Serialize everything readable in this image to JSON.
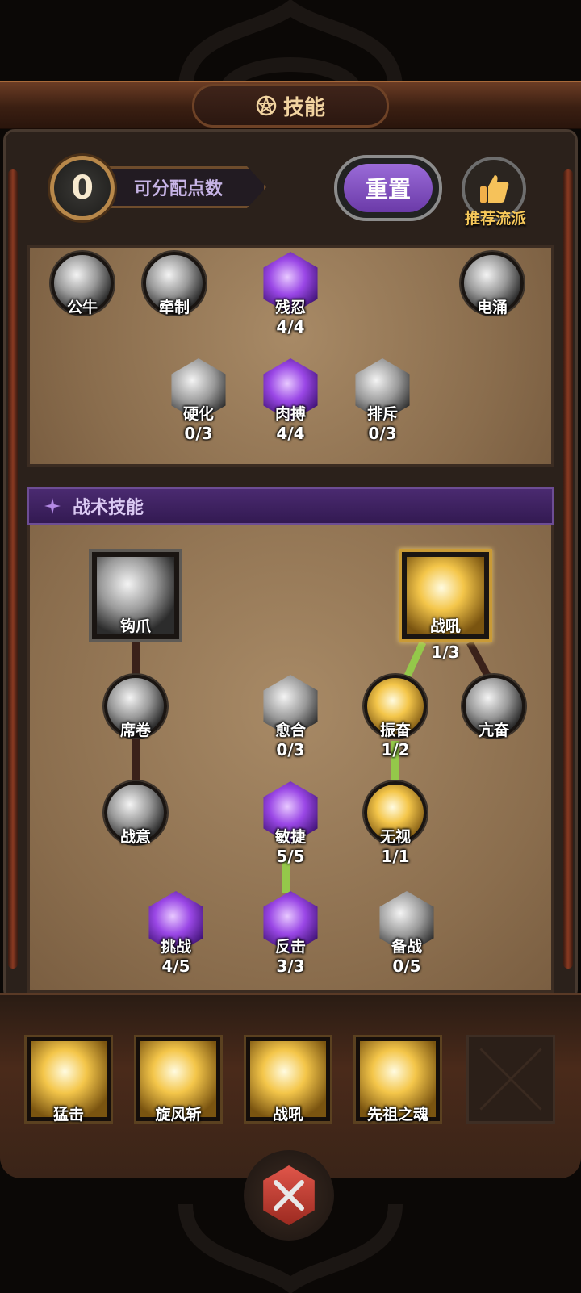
{
  "title": {
    "text": "技能",
    "icon": "pentagram-icon"
  },
  "points": {
    "value": "0",
    "label": "可分配点数"
  },
  "reset_button": "重置",
  "recommend_button": "推荐流派",
  "passive_tree": {
    "row1": [
      {
        "name": "公牛",
        "count": "",
        "style": "gray"
      },
      {
        "name": "牵制",
        "count": "",
        "style": "gray"
      },
      {
        "name": "残忍",
        "count": "4/4",
        "style": "purple"
      },
      {
        "name": "电涌",
        "count": "",
        "style": "gray"
      }
    ],
    "row2": [
      {
        "name": "硬化",
        "count": "0/3",
        "style": "gray"
      },
      {
        "name": "肉搏",
        "count": "4/4",
        "style": "purple"
      },
      {
        "name": "排斥",
        "count": "0/3",
        "style": "gray"
      }
    ]
  },
  "tactical_header": "战术技能",
  "tactical_tree": {
    "hook": {
      "name": "钩爪",
      "count": ""
    },
    "warcry": {
      "name": "战吼",
      "count": "1/3"
    },
    "nodes": {
      "xijuan": {
        "name": "席卷",
        "count": ""
      },
      "zhanyi": {
        "name": "战意",
        "count": ""
      },
      "yuhe": {
        "name": "愈合",
        "count": "0/3"
      },
      "minjie": {
        "name": "敏捷",
        "count": "5/5"
      },
      "zhenfen": {
        "name": "振奋",
        "count": "1/2"
      },
      "kangfen": {
        "name": "亢奋",
        "count": ""
      },
      "wushi": {
        "name": "无视",
        "count": "1/1"
      },
      "tiaozhan": {
        "name": "挑战",
        "count": "4/5"
      },
      "fanji": {
        "name": "反击",
        "count": "3/3"
      },
      "beizhan": {
        "name": "备战",
        "count": "0/5"
      }
    }
  },
  "equipped_skills": [
    "猛击",
    "旋风斩",
    "战吼",
    "先祖之魂"
  ],
  "colors": {
    "accent_purple": "#6b3aa8",
    "gold": "#f4c64a",
    "link_active": "#94c84a"
  }
}
